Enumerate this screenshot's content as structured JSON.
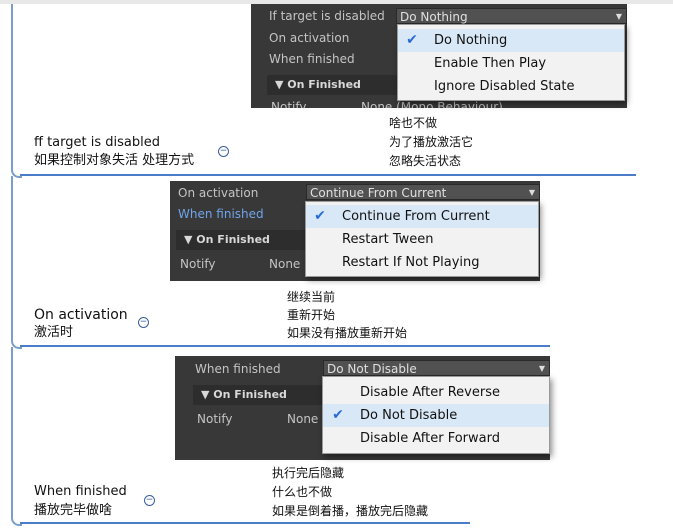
{
  "nodes": [
    {
      "label_line1": "ff target is disabled",
      "label_line2": "如果控制对象失活 处理方式",
      "collapse_symbol": "−",
      "notes": [
        "啥也不做",
        "为了播放激活它",
        "忽略失活状态"
      ],
      "panel": {
        "rows": [
          "If target is disabled",
          "On activation",
          "When finished"
        ],
        "dropdown_value": "Do Nothing",
        "foldout": "▼ On Finished",
        "notify_label": "Notify",
        "notify_value": "None (Mono Behaviour)",
        "menu": [
          {
            "label": "Do Nothing",
            "checked": true
          },
          {
            "label": "Enable Then Play",
            "checked": false
          },
          {
            "label": "Ignore Disabled State",
            "checked": false
          }
        ]
      }
    },
    {
      "label_line1": "On activation",
      "label_line2": "激活时",
      "collapse_symbol": "−",
      "notes": [
        "继续当前",
        "重新开始",
        "如果没有播放重新开始"
      ],
      "panel": {
        "rows": [
          "On activation",
          "When finished"
        ],
        "dropdown_value": "Continue From Current",
        "foldout": "▼ On Finished",
        "notify_label": "Notify",
        "notify_value": "None",
        "menu": [
          {
            "label": "Continue From Current",
            "checked": true
          },
          {
            "label": "Restart Tween",
            "checked": false
          },
          {
            "label": "Restart If Not Playing",
            "checked": false
          }
        ]
      }
    },
    {
      "label_line1": "When finished",
      "label_line2": "播放完毕做啥",
      "collapse_symbol": "−",
      "notes": [
        "执行完后隐藏",
        "什么也不做",
        "如果是倒着播，播放完后隐藏"
      ],
      "panel": {
        "rows": [
          "When finished"
        ],
        "dropdown_value": "Do Not Disable",
        "foldout": "▼ On Finished",
        "notify_label": "Notify",
        "notify_value": "None",
        "menu": [
          {
            "label": "Disable After Reverse",
            "checked": false
          },
          {
            "label": "Do Not Disable",
            "checked": true
          },
          {
            "label": "Disable After Forward",
            "checked": false
          }
        ]
      }
    }
  ],
  "check_glyph": "✔",
  "dropdown_arrow": "▼"
}
